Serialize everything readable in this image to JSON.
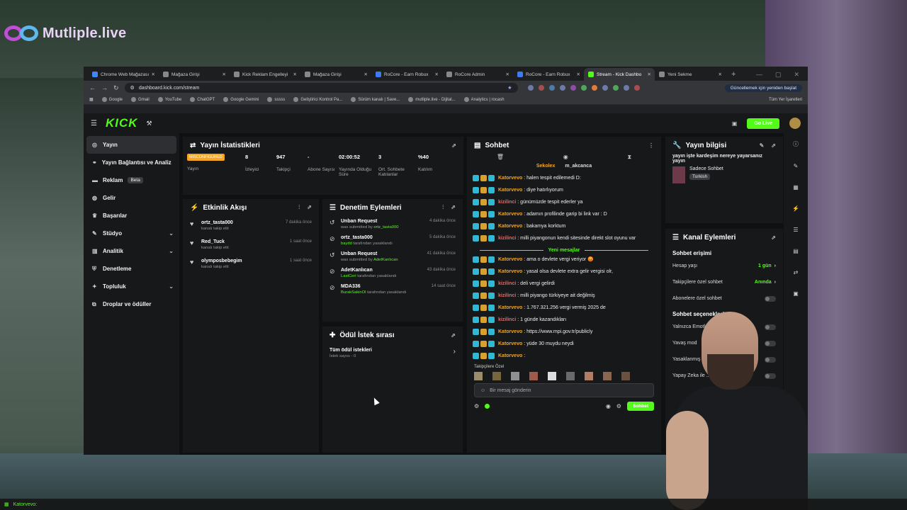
{
  "overlay": {
    "brand": "Mutliple.live"
  },
  "browser": {
    "tabs": [
      {
        "label": "Chrome Web Mağazası",
        "color": "#4285f4"
      },
      {
        "label": "Mağaza Girişi",
        "color": "#888888"
      },
      {
        "label": "Kick Reklam Engelleyi",
        "color": "#888888"
      },
      {
        "label": "Mağaza Girişi",
        "color": "#888888"
      },
      {
        "label": "RoCore - Earn Robux",
        "color": "#3d7bf0"
      },
      {
        "label": "RoCore Admin",
        "color": "#888888"
      },
      {
        "label": "RoCore - Earn Robux",
        "color": "#3d7bf0"
      },
      {
        "label": "Stream - Kick Dashbo",
        "color": "#53fc18"
      },
      {
        "label": "Yeni Sekme",
        "color": "#888888"
      }
    ],
    "url": "dashboard.kick.com/stream",
    "update_label": "Güncellemek için yeniden başlat",
    "bookmarks": [
      "Google",
      "Gmail",
      "YouTube",
      "ChatGPT",
      "Google Gemini",
      "sssss",
      "Geliştirici Kontrol Pa...",
      "Sürüm kanalı | Save...",
      "mutliple.live - Dijital...",
      "Analytics | rocash"
    ],
    "bookmarks_right": "Tüm Yer İşaretleri"
  },
  "kick": {
    "logo": "KICK",
    "golive": "Go Live",
    "sidebar": [
      {
        "label": "Yayın",
        "icon": "broadcast-icon",
        "active": true
      },
      {
        "label": "Yayın Bağlantısı ve Analiz",
        "icon": "link-icon"
      },
      {
        "label": "Reklam",
        "icon": "ad-icon",
        "badge": "Beta"
      },
      {
        "label": "Gelir",
        "icon": "coin-icon"
      },
      {
        "label": "Başarılar",
        "icon": "trophy-icon"
      },
      {
        "label": "Stüdyo",
        "icon": "studio-icon",
        "chevron": true
      },
      {
        "label": "Analitik",
        "icon": "chart-icon",
        "chevron": true
      },
      {
        "label": "Denetleme",
        "icon": "shield-icon"
      },
      {
        "label": "Topluluk",
        "icon": "community-icon",
        "chevron": true
      },
      {
        "label": "Droplar ve ödüller",
        "icon": "gift-icon"
      }
    ],
    "stats": {
      "title": "Yayın İstatistikleri",
      "items": [
        {
          "value": "MISCONFIGURED",
          "label": "Yayın",
          "misconfigured": true
        },
        {
          "value": "8",
          "label": "İzleyici"
        },
        {
          "value": "947",
          "label": "Takipçi"
        },
        {
          "value": "-",
          "label": "Abone Sayısı"
        },
        {
          "value": "02:00:52",
          "label": "Yayında Olduğu Süre"
        },
        {
          "value": "3",
          "label": "Ort. Sohbete Katılanlar"
        },
        {
          "value": "%40",
          "label": "Katılım"
        }
      ]
    },
    "activity": {
      "title": "Etkinlik Akışı",
      "items": [
        {
          "name": "ortz_tasta000",
          "sub": "kanalı takip etti",
          "time": "7 dakika önce"
        },
        {
          "name": "Red_Tuck",
          "sub": "kanalı takip etti",
          "time": "1 saat önce"
        },
        {
          "name": "olymposbebegim",
          "sub": "kanalı takip etti",
          "time": "1 saat önce"
        }
      ]
    },
    "moderation": {
      "title": "Denetim Eylemleri",
      "items": [
        {
          "name": "Unban Request",
          "pre": "was submitted by ",
          "who": "ortz_tasta000",
          "post": "",
          "time": "4 dakika önce"
        },
        {
          "name": "ortz_tasta000",
          "pre": "",
          "who": "baydd",
          "post": " tarafından yasaklandı",
          "time": "5 dakika önce"
        },
        {
          "name": "Unban Request",
          "pre": "was submitted by ",
          "who": "AdetKanlıcan",
          "post": "",
          "time": "41 dakika önce"
        },
        {
          "name": "AdetKanlıcan",
          "pre": "",
          "who": "LastCeri",
          "post": " tarafından yasaklandı",
          "time": "43 dakika önce"
        },
        {
          "name": "MDA336",
          "pre": "",
          "who": "BurakSakinOl",
          "post": " tarafından yasaklandı",
          "time": "14 saat önce"
        }
      ]
    },
    "rewards": {
      "title": "Ödül İstek sırası",
      "item": "Tüm ödül istekleri",
      "sub": "İstek sayısı - 0"
    },
    "chat": {
      "title": "Sohbet",
      "pinned": [
        "Sekolex",
        "m_akcanca"
      ],
      "messages": [
        {
          "user": "Katorvevo",
          "color": "#f5a623",
          "text": ": halen tespit edilemedi D:"
        },
        {
          "user": "Katorvevo",
          "color": "#f5a623",
          "text": ": diye hatırlıyorum"
        },
        {
          "user": "kizilinci",
          "color": "#ff5a5a",
          "text": ": günümüzde tespit ederler ya"
        },
        {
          "user": "Katorvevo",
          "color": "#f5a623",
          "text": ": adamın profilinde garip bi link var : D"
        },
        {
          "user": "Katorvevo",
          "color": "#f5a623",
          "text": ": bakamya korktum"
        },
        {
          "user": "kizilinci",
          "color": "#ff5a5a",
          "text": ": milli piyangonun kendi sitesinde direkt slot oyunu var"
        }
      ],
      "new_label": "Yeni mesajlar",
      "new_messages": [
        {
          "user": "Katorvevo",
          "color": "#f5a623",
          "text": ": ama o devlete vergi veriyor 😡"
        },
        {
          "user": "Katorvevo",
          "color": "#f5a623",
          "text": ": yasal olsa devlete extra gelir vergisi olr,"
        },
        {
          "user": "kizilinci",
          "color": "#ff5a5a",
          "text": ": deli vergi gelirdi"
        },
        {
          "user": "kizilinci",
          "color": "#ff5a5a",
          "text": ": milli piyango türkiyeye ait değilmiş"
        },
        {
          "user": "Katorvevo",
          "color": "#f5a623",
          "text": ": 1.767.321.256 vergi vermiş 2025 de"
        },
        {
          "user": "kizilinci",
          "color": "#ff5a5a",
          "text": ": 1 günde kazandıkları"
        },
        {
          "user": "Katorvevo",
          "color": "#f5a623",
          "text": ": https://www.mpi.gov.tr/publicly"
        },
        {
          "user": "Katorvevo",
          "color": "#f5a623",
          "text": ": yüde 30 muydu neydi"
        },
        {
          "user": "Katorvevo",
          "color": "#f5a623",
          "text": ":"
        }
      ],
      "followers_only": "Takipçilere Özel",
      "placeholder": "Bir mesaj gönderin",
      "send": "Sohbet"
    },
    "streaminfo": {
      "title": "Yayın bilgisi",
      "desc": "yayın işte kardeşim nereye yayarsanız yayın",
      "category": "Sadece Sohbet",
      "lang": "Turkish"
    },
    "channel": {
      "title": "Kanal Eylemleri",
      "access_title": "Sohbet erişimi",
      "access": [
        {
          "label": "Hesap yaşı",
          "value": "1 gün"
        },
        {
          "label": "Takipçilere özel sohbet",
          "value": "Anında"
        },
        {
          "label": "Abonelere özel sohbet",
          "toggle": true
        }
      ],
      "options_title": "Sohbet seçenekleri",
      "options": [
        "Yalnızca Emotlarla sohbet",
        "Yavaş mod",
        "Yasaklanmış kelimeler",
        "Yapay Zeka ile ... denetimi"
      ]
    }
  },
  "taskbar": {
    "text": "Katorvevo:"
  }
}
